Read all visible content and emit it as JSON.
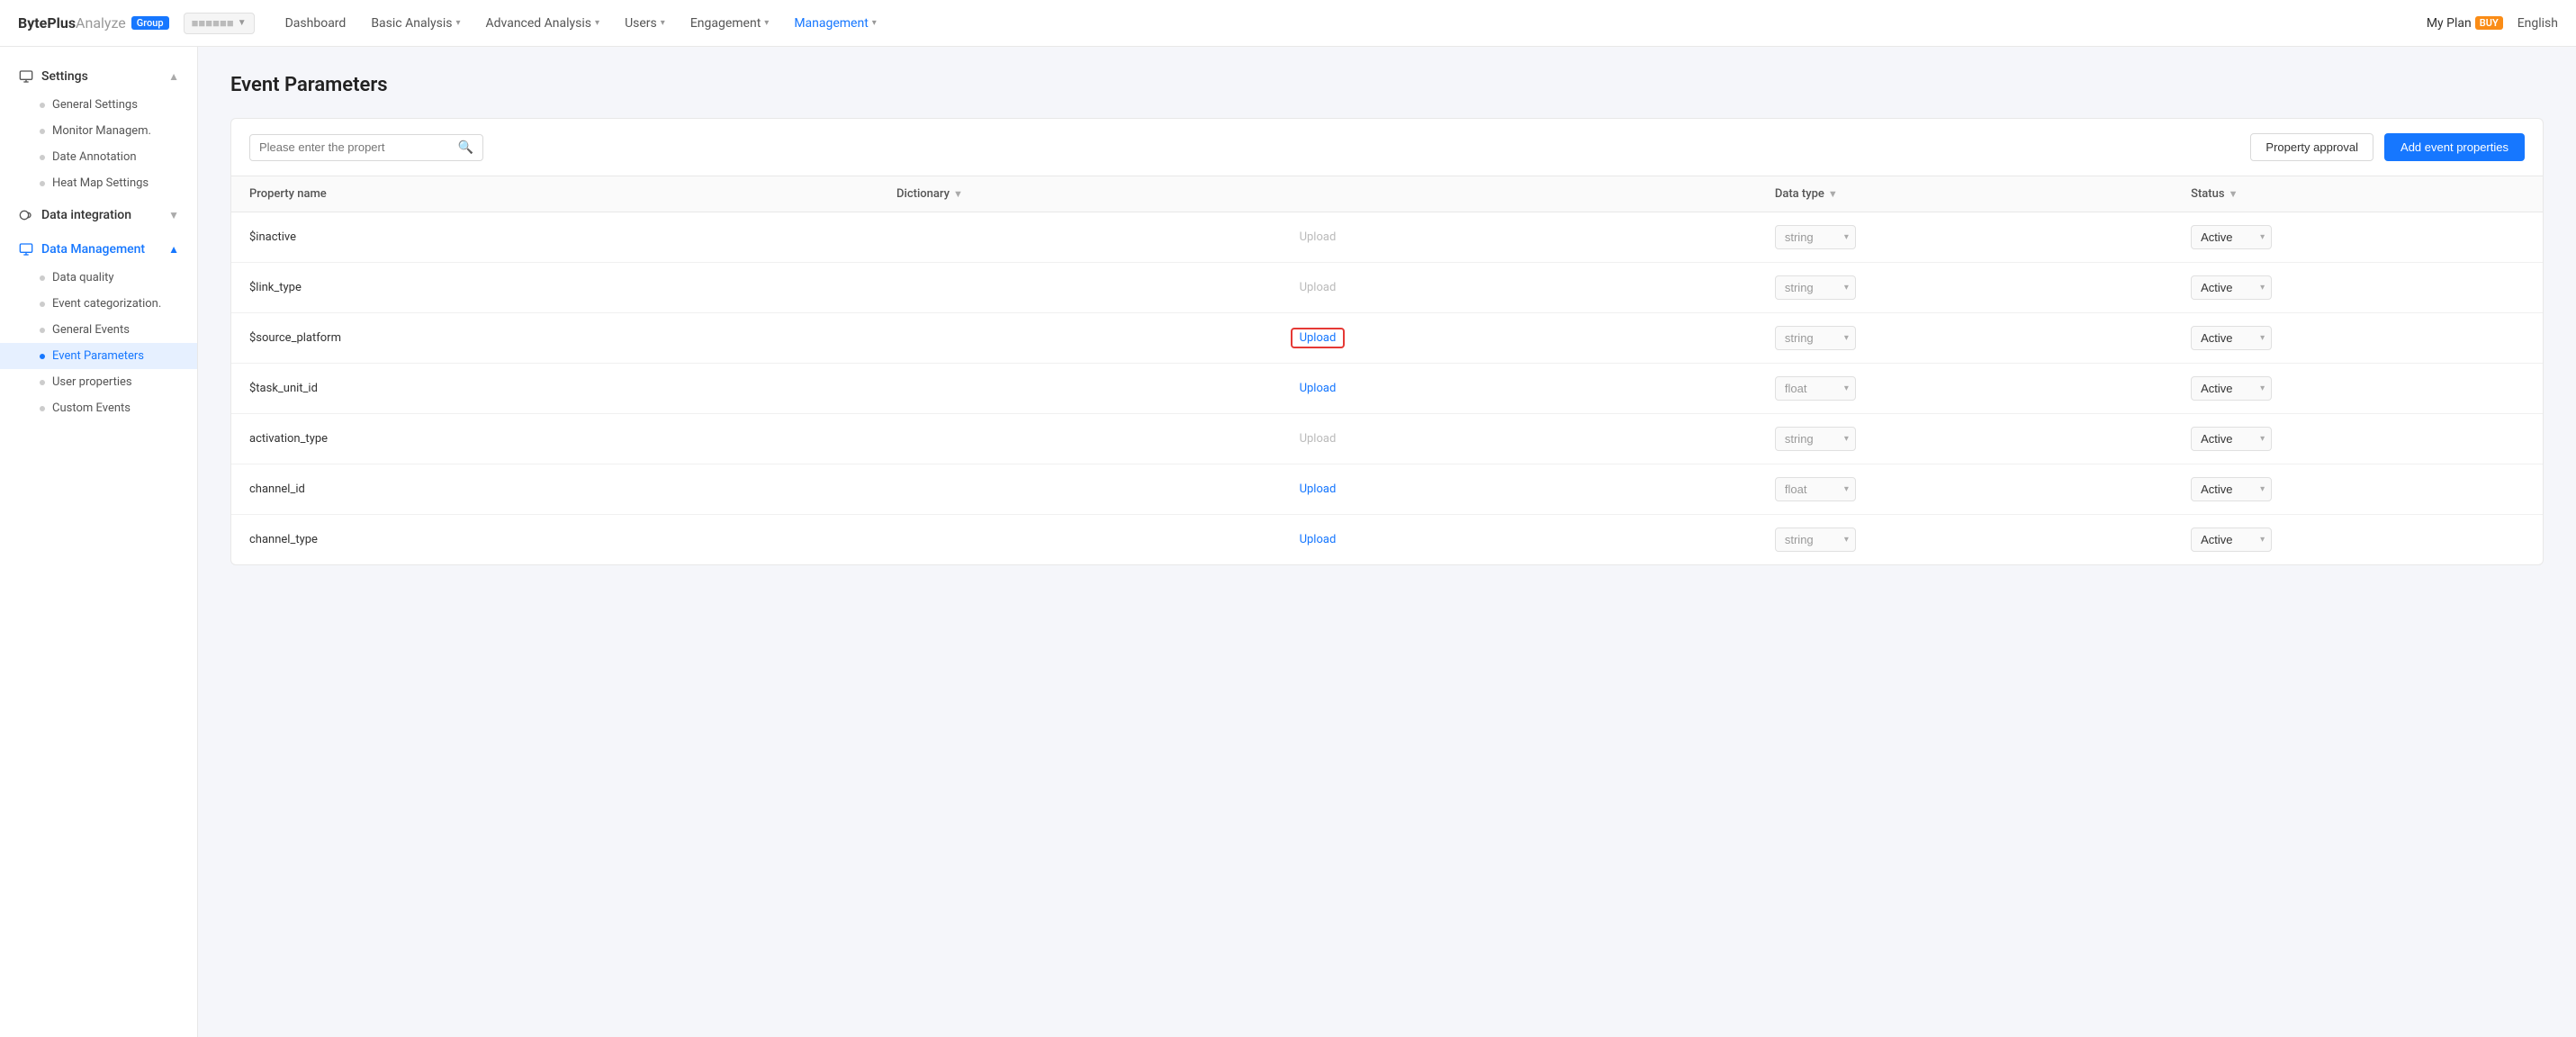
{
  "brand": {
    "name": "BytePlus",
    "analyze": "Analyze",
    "badge": "Group",
    "project": "■■■■■■■■"
  },
  "nav": {
    "items": [
      {
        "label": "Dashboard",
        "hasDropdown": false,
        "active": false
      },
      {
        "label": "Basic Analysis",
        "hasDropdown": true,
        "active": false
      },
      {
        "label": "Advanced Analysis",
        "hasDropdown": true,
        "active": false
      },
      {
        "label": "Users",
        "hasDropdown": true,
        "active": false
      },
      {
        "label": "Engagement",
        "hasDropdown": true,
        "active": false
      },
      {
        "label": "Management",
        "hasDropdown": true,
        "active": true
      }
    ],
    "myPlan": "My Plan",
    "buyBadge": "BUY",
    "language": "English"
  },
  "sidebar": {
    "sections": [
      {
        "label": "Settings",
        "icon": "settings-icon",
        "expanded": true,
        "items": [
          {
            "label": "General Settings",
            "active": false
          },
          {
            "label": "Monitor Managem.",
            "active": false
          },
          {
            "label": "Date Annotation",
            "active": false
          },
          {
            "label": "Heat Map Settings",
            "active": false
          }
        ]
      },
      {
        "label": "Data integration",
        "icon": "data-integration-icon",
        "expanded": false,
        "items": []
      },
      {
        "label": "Data Management",
        "icon": "data-management-icon",
        "expanded": true,
        "items": [
          {
            "label": "Data quality",
            "active": false
          },
          {
            "label": "Event categorization.",
            "active": false
          },
          {
            "label": "General Events",
            "active": false
          },
          {
            "label": "Event Parameters",
            "active": true
          },
          {
            "label": "User properties",
            "active": false
          },
          {
            "label": "Custom Events",
            "active": false
          }
        ]
      }
    ]
  },
  "page": {
    "title": "Event Parameters"
  },
  "toolbar": {
    "search_placeholder": "Please enter the propert",
    "property_approval": "Property approval",
    "add_event_properties": "Add event properties"
  },
  "table": {
    "columns": [
      {
        "label": "Property name",
        "hasFilter": false
      },
      {
        "label": "Dictionary",
        "hasFilter": true
      },
      {
        "label": "Data type",
        "hasFilter": true
      },
      {
        "label": "Status",
        "hasFilter": true
      }
    ],
    "rows": [
      {
        "property": "$inactive",
        "upload": "Upload",
        "uploadType": "plain",
        "dataType": "string",
        "status": "Active"
      },
      {
        "property": "$link_type",
        "upload": "Upload",
        "uploadType": "plain",
        "dataType": "string",
        "status": "Active"
      },
      {
        "property": "$source_platform",
        "upload": "Upload",
        "uploadType": "highlighted",
        "dataType": "string",
        "status": "Active"
      },
      {
        "property": "$task_unit_id",
        "upload": "Upload",
        "uploadType": "link",
        "dataType": "float",
        "status": "Active"
      },
      {
        "property": "activation_type",
        "upload": "Upload",
        "uploadType": "plain",
        "dataType": "string",
        "status": "Active"
      },
      {
        "property": "channel_id",
        "upload": "Upload",
        "uploadType": "link",
        "dataType": "float",
        "status": "Active"
      },
      {
        "property": "channel_type",
        "upload": "Upload",
        "uploadType": "link",
        "dataType": "string",
        "status": "Active"
      }
    ]
  }
}
